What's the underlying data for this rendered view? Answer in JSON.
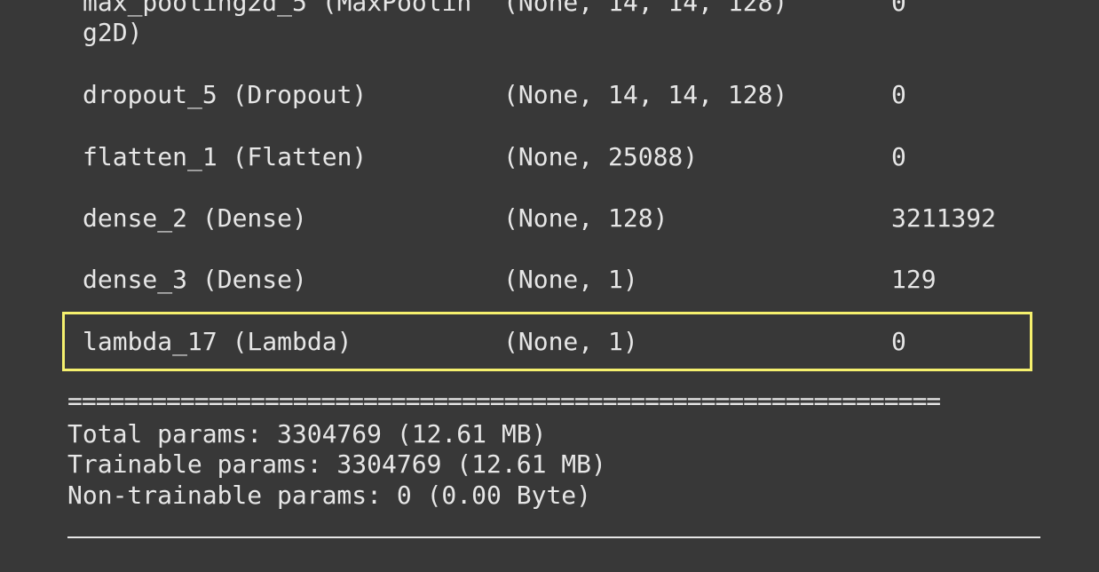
{
  "layers": [
    {
      "name": "max_pooling2d_5 (MaxPoolin\ng2D)",
      "shape": "(None, 14, 14, 128)",
      "params": "0"
    },
    {
      "name": "dropout_5 (Dropout)",
      "shape": "(None, 14, 14, 128)",
      "params": "0"
    },
    {
      "name": "flatten_1 (Flatten)",
      "shape": "(None, 25088)",
      "params": "0"
    },
    {
      "name": "dense_2 (Dense)",
      "shape": "(None, 128)",
      "params": "3211392"
    },
    {
      "name": "dense_3 (Dense)",
      "shape": "(None, 1)",
      "params": "129"
    },
    {
      "name": "lambda_17 (Lambda)",
      "shape": "(None, 1)",
      "params": "0"
    }
  ],
  "highlighted_layer": "lambda_17 (Lambda)",
  "highlight_color": "#f5f06e",
  "separator_double": "==============================================================",
  "summary": {
    "total": "Total params: 3304769 (12.61 MB)",
    "trainable": "Trainable params: 3304769 (12.61 MB)",
    "non_trainable": "Non-trainable params: 0 (0.00 Byte)"
  },
  "colors": {
    "background": "#383838",
    "text": "#e6e6e6"
  }
}
